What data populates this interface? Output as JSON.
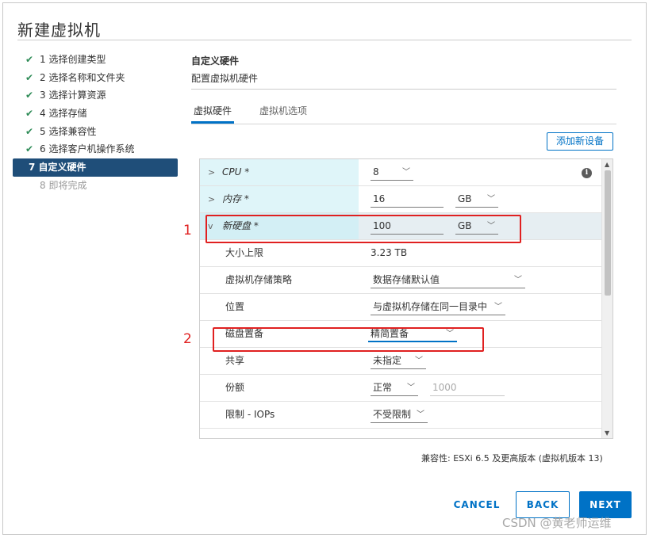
{
  "dialog": {
    "title": "新建虚拟机"
  },
  "steps": [
    {
      "label": "1 选择创建类型",
      "status": "done"
    },
    {
      "label": "2 选择名称和文件夹",
      "status": "done"
    },
    {
      "label": "3 选择计算资源",
      "status": "done"
    },
    {
      "label": "4 选择存储",
      "status": "done"
    },
    {
      "label": "5 选择兼容性",
      "status": "done"
    },
    {
      "label": "6 选择客户机操作系统",
      "status": "done"
    },
    {
      "label": "7 自定义硬件",
      "status": "active"
    },
    {
      "label": "8 即将完成",
      "status": "pending"
    }
  ],
  "check_glyph": "✔",
  "panel": {
    "title": "自定义硬件",
    "subtitle": "配置虚拟机硬件"
  },
  "tabs": [
    {
      "label": "虚拟硬件",
      "active": true
    },
    {
      "label": "虚拟机选项",
      "active": false
    }
  ],
  "add_device_label": "添加新设备",
  "hardware": {
    "cpu": {
      "label": "CPU *",
      "value": "8"
    },
    "memory": {
      "label": "内存 *",
      "value": "16",
      "unit": "GB"
    },
    "new_disk": {
      "label": "新硬盘 *",
      "value": "100",
      "unit": "GB"
    },
    "max_size": {
      "label": "大小上限",
      "value": "3.23 TB"
    },
    "storage_policy": {
      "label": "虚拟机存储策略",
      "value": "数据存储默认值"
    },
    "location": {
      "label": "位置",
      "value": "与虚拟机存储在同一目录中"
    },
    "provisioning": {
      "label": "磁盘置备",
      "value": "精简置备"
    },
    "sharing": {
      "label": "共享",
      "value": "未指定"
    },
    "shares": {
      "label": "份额",
      "value": "正常",
      "number": "1000"
    },
    "limit_iops": {
      "label": "限制 - IOPs",
      "value": "不受限制"
    }
  },
  "annotations": {
    "one": "1",
    "two": "2"
  },
  "compat_text": "兼容性: ESXi 6.5 及更高版本 (虚拟机版本 13)",
  "buttons": {
    "cancel": "CANCEL",
    "back": "BACK",
    "next": "NEXT"
  },
  "watermark": "CSDN @黄老师运维",
  "colors": {
    "accent": "#0072c6",
    "active_step": "#1f4e79",
    "annotation": "#e02020",
    "check": "#2e8b57"
  }
}
